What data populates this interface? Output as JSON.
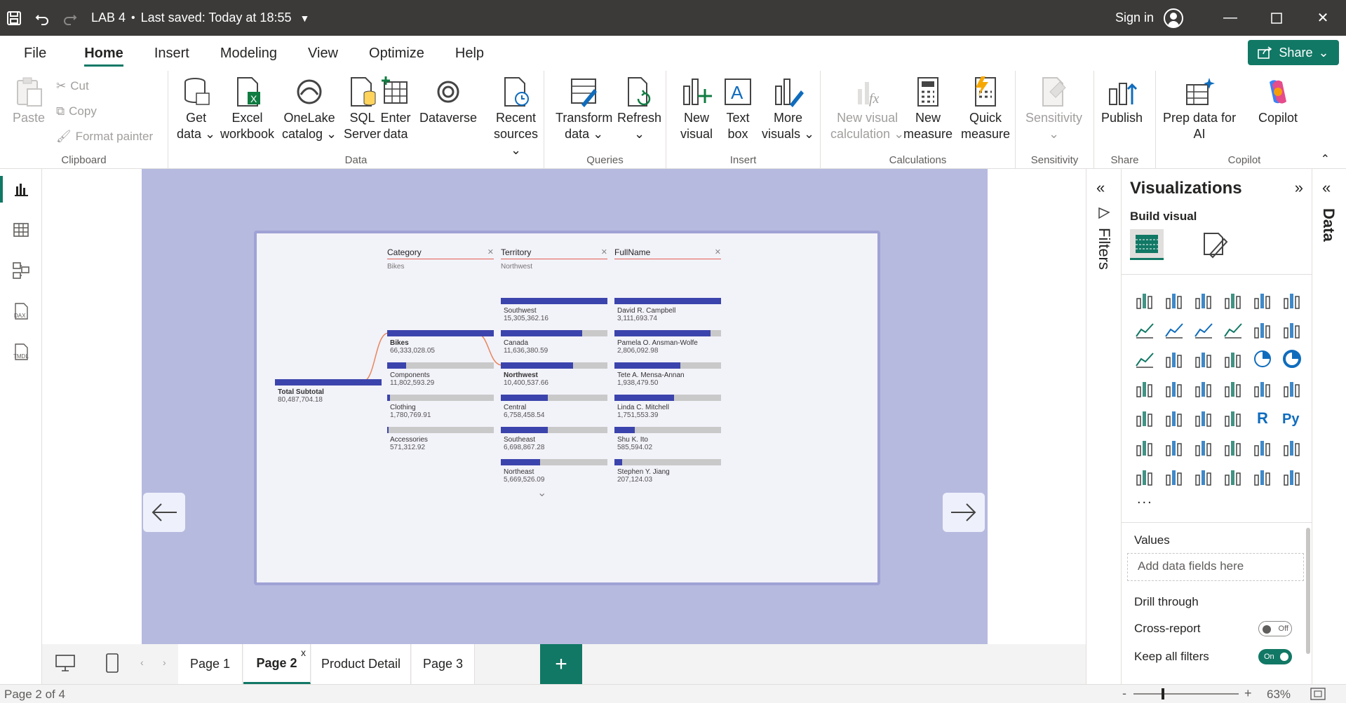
{
  "titlebar": {
    "file_title": "LAB 4",
    "separator": "•",
    "saved_status": "Last saved: Today at 18:55",
    "sign_in": "Sign in"
  },
  "menu": {
    "tabs": [
      "File",
      "Home",
      "Insert",
      "Modeling",
      "View",
      "Optimize",
      "Help"
    ],
    "share": "Share"
  },
  "ribbon": {
    "clipboard": {
      "paste": "Paste",
      "cut": "Cut",
      "copy": "Copy",
      "format_painter": "Format painter",
      "label": "Clipboard"
    },
    "data": {
      "get_data": [
        "Get",
        "data"
      ],
      "excel": [
        "Excel",
        "workbook"
      ],
      "onelake": [
        "OneLake",
        "catalog"
      ],
      "sql": [
        "SQL",
        "Server"
      ],
      "enter": [
        "Enter",
        "data"
      ],
      "dataverse": [
        "Dataverse",
        ""
      ],
      "recent": [
        "Recent",
        "sources"
      ],
      "label": "Data"
    },
    "queries": {
      "transform": [
        "Transform",
        "data"
      ],
      "refresh": [
        "Refresh",
        ""
      ],
      "label": "Queries"
    },
    "insert": {
      "new_visual": [
        "New",
        "visual"
      ],
      "text_box": [
        "Text",
        "box"
      ],
      "more_visuals": [
        "More",
        "visuals"
      ],
      "label": "Insert"
    },
    "calculations": {
      "new_visual_calc": [
        "New visual",
        "calculation"
      ],
      "new_measure": [
        "New",
        "measure"
      ],
      "quick_measure": [
        "Quick",
        "measure"
      ],
      "label": "Calculations"
    },
    "sensitivity": {
      "btn": [
        "Sensitivity",
        ""
      ],
      "label": "Sensitivity"
    },
    "share": {
      "publish": [
        "Publish",
        ""
      ],
      "label": "Share"
    },
    "copilot": {
      "prep": [
        "Prep data for",
        "AI"
      ],
      "copilot": [
        "Copilot",
        ""
      ],
      "label": "Copilot"
    }
  },
  "decomp_tree": {
    "columns": [
      {
        "header": "Category",
        "selected": "Bikes"
      },
      {
        "header": "Territory",
        "selected": "Northwest"
      },
      {
        "header": "FullName",
        "selected": ""
      }
    ],
    "root": {
      "label": "Total Subtotal",
      "value": "80,487,704.18"
    },
    "category_nodes": [
      {
        "label": "Bikes",
        "value": "66,333,028.05",
        "fraction": 1.0,
        "bold": true
      },
      {
        "label": "Components",
        "value": "11,802,593.29",
        "fraction": 0.178,
        "bold": false
      },
      {
        "label": "Clothing",
        "value": "1,780,769.91",
        "fraction": 0.027,
        "bold": false
      },
      {
        "label": "Accessories",
        "value": "571,312.92",
        "fraction": 0.009,
        "bold": false
      }
    ],
    "territory_nodes": [
      {
        "label": "Southwest",
        "value": "15,305,362.16",
        "fraction": 1.0,
        "bold": false
      },
      {
        "label": "Canada",
        "value": "11,636,380.59",
        "fraction": 0.76,
        "bold": false
      },
      {
        "label": "Northwest",
        "value": "10,400,537.66",
        "fraction": 0.68,
        "bold": true
      },
      {
        "label": "Central",
        "value": "6,758,458.54",
        "fraction": 0.44,
        "bold": false
      },
      {
        "label": "Southeast",
        "value": "6,698,867.28",
        "fraction": 0.44,
        "bold": false
      },
      {
        "label": "Northeast",
        "value": "5,669,526.09",
        "fraction": 0.37,
        "bold": false
      }
    ],
    "name_nodes": [
      {
        "label": "David R. Campbell",
        "value": "3,111,693.74",
        "fraction": 1.0
      },
      {
        "label": "Pamela O. Ansman-Wolfe",
        "value": "2,806,092.98",
        "fraction": 0.9
      },
      {
        "label": "Tete A. Mensa-Annan",
        "value": "1,938,479.50",
        "fraction": 0.62
      },
      {
        "label": "Linda C. Mitchell",
        "value": "1,751,553.39",
        "fraction": 0.56
      },
      {
        "label": "Shu K. Ito",
        "value": "585,594.02",
        "fraction": 0.19
      },
      {
        "label": "Stephen Y. Jiang",
        "value": "207,124.03",
        "fraction": 0.07
      }
    ]
  },
  "pages": {
    "tabs": [
      "Page 1",
      "Page 2",
      "Product Detail",
      "Page 3"
    ],
    "active": "Page 2",
    "close": "x",
    "add": "+"
  },
  "status": {
    "page_indicator": "Page 2 of 4",
    "zoom": "63%",
    "minus": "-",
    "plus": "+"
  },
  "filters_pane": {
    "title": "Filters"
  },
  "viz_pane": {
    "title": "Visualizations",
    "build_visual": "Build visual",
    "more": "...",
    "values_label": "Values",
    "add_fields": "Add data fields here",
    "drill_through": "Drill through",
    "cross_report": "Cross-report",
    "cross_report_state": "Off",
    "keep_filters": "Keep all filters",
    "keep_filters_state": "On"
  },
  "data_pane": {
    "title": "Data"
  },
  "colors": {
    "accent": "#117865",
    "bar": "#3b44ac",
    "page_bg": "#b6badf",
    "titlebar": "#3b3a39"
  }
}
